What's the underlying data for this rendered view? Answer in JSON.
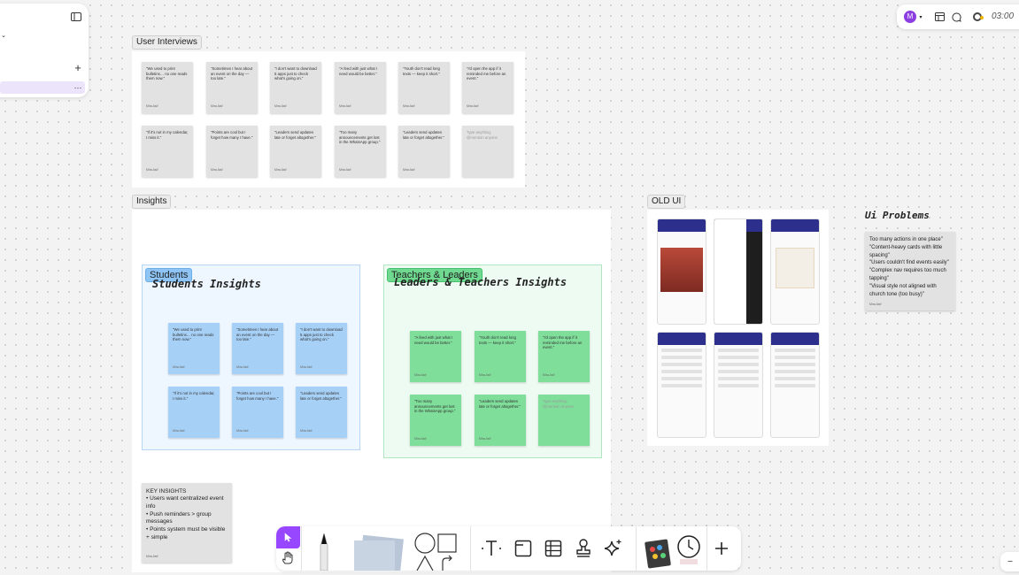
{
  "topbar": {
    "avatar_letter": "M",
    "timer": "03:00"
  },
  "sections": {
    "user_interviews": {
      "label": "User Interviews"
    },
    "insights": {
      "label": "Insights"
    },
    "old_ui": {
      "label": "OLD UI"
    }
  },
  "interview_notes": [
    {
      "text": "\"We used to print bulletins… no one reads them now.\"",
      "author": "Mira Asif"
    },
    {
      "text": "\"Sometimes I hear about an event on the day — too late.\"",
      "author": "Mira Asif"
    },
    {
      "text": "\"I don't want to download 5 apps just to check what's going on.\"",
      "author": "Mira Asif"
    },
    {
      "text": "\"A feed with just what I need would be better.\"",
      "author": "Mira Asif"
    },
    {
      "text": "\"Youth don't read long texts — keep it short.\"",
      "author": "Mira Asif"
    },
    {
      "text": "\"I'd open the app if it reminded me before an event.\"",
      "author": "Mira Asif"
    },
    {
      "text": "\"If it's not in my calendar, I miss it.\"",
      "author": "Mira Asif"
    },
    {
      "text": "\"Points are cool but I forget how many I have.\"",
      "author": "Mira Asif"
    },
    {
      "text": "\"Leaders send updates late or forget altogether.\"",
      "author": "Mira Asif"
    },
    {
      "text": "\"Too many announcements get lost in the WhatsApp group.\"",
      "author": "Mira Asif"
    },
    {
      "text": "\"Leaders send updates late or forget altogether.\"",
      "author": "Mira Asif"
    },
    {
      "placeholder": "Type anything, @mention anyone"
    }
  ],
  "students": {
    "tag": "Students",
    "title": "Students Insights",
    "notes": [
      {
        "text": "\"We used to print bulletins… no one reads them now.\"",
        "author": "Mira Asif"
      },
      {
        "text": "\"Sometimes I hear about an event on the day — too late.\"",
        "author": "Mira Asif"
      },
      {
        "text": "\"I don't want to download 5 apps just to check what's going on.\"",
        "author": "Mira Asif"
      },
      {
        "text": "\"If it's not in my calendar, I miss it.\"",
        "author": "Mira Asif"
      },
      {
        "text": "\"Points are cool but I forget how many I have.\"",
        "author": "Mira Asif"
      },
      {
        "text": "\"Leaders send updates late or forget altogether.\"",
        "author": "Mira Asif"
      }
    ]
  },
  "leaders": {
    "tag": "Teachers & Leaders",
    "title": "Leaders & Teachers Insights",
    "notes": [
      {
        "text": "\"A feed with just what I need would be better.\"",
        "author": "Mira Asif"
      },
      {
        "text": "\"Youth don't read long texts — keep it short.\"",
        "author": "Mira Asif"
      },
      {
        "text": "\"I'd open the app if it reminded me before an event.\"",
        "author": "Mira Asif"
      },
      {
        "text": "\"Too many announcements get lost in the WhatsApp group.\"",
        "author": "Mira Asif"
      },
      {
        "text": "\"Leaders send updates late or forget altogether.\"",
        "author": "Mira Asif"
      },
      {
        "placeholder": "Type anything, @mention anyone"
      }
    ]
  },
  "key_insights": {
    "title": "KEY INSIGHTS",
    "lines": [
      "• Users want centralized event info",
      "• Push reminders > group messages",
      "• Points system must be visible + simple"
    ],
    "author": "Mira Asif"
  },
  "ui_problems": {
    "title": "Ui Problems",
    "lines": [
      "Too many actions in one place\"",
      "\"Content-heavy cards with little spacing\"",
      "\"Users couldn't find events easily\"",
      "\"Complex nav requires too much tapping\"",
      "\"Visual style not aligned with church tone (too busy)\""
    ],
    "author": "Mira Asif"
  },
  "toolbar": {
    "items": [
      {
        "name": "select-tool-button",
        "icon": "cursor-icon"
      },
      {
        "name": "hand-tool-button",
        "icon": "hand-icon"
      },
      {
        "name": "pen-tool-button",
        "icon": "pen-icon"
      },
      {
        "name": "sticky-note-tool-button",
        "icon": "sticky-note-icon"
      },
      {
        "name": "shapes-tool-button",
        "icon": "shapes-icon"
      },
      {
        "name": "text-tool-button",
        "icon": "text-icon"
      },
      {
        "name": "section-tool-button",
        "icon": "section-icon"
      },
      {
        "name": "table-tool-button",
        "icon": "table-icon"
      },
      {
        "name": "stamp-tool-button",
        "icon": "stamp-icon"
      },
      {
        "name": "ai-tool-button",
        "icon": "sparkle-icon"
      },
      {
        "name": "widgets-tool-button",
        "icon": "widgets-icon"
      },
      {
        "name": "timer-tool-button",
        "icon": "clock-icon"
      },
      {
        "name": "more-tools-button",
        "icon": "plus-icon"
      }
    ]
  },
  "colors": {
    "accent": "#9747ff",
    "student_frame": "#eef7ff",
    "leader_frame": "#edfbf2"
  }
}
